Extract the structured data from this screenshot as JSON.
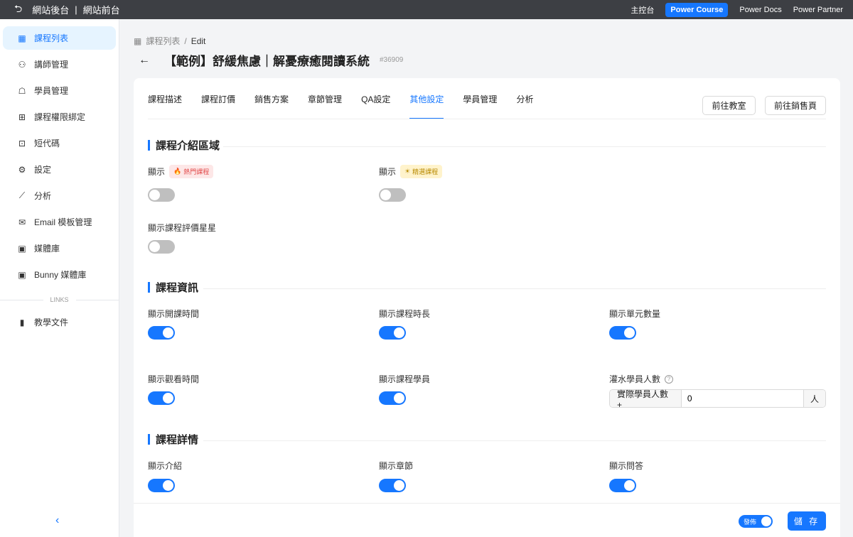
{
  "topbar": {
    "back_label": "網站後台",
    "sep": "|",
    "front_label": "網站前台",
    "links": [
      "主控台",
      "Power Course",
      "Power Docs",
      "Power Partner"
    ]
  },
  "sidebar": {
    "items": [
      {
        "label": "課程列表",
        "icon": "table-icon"
      },
      {
        "label": "講師管理",
        "icon": "user-icon"
      },
      {
        "label": "學員管理",
        "icon": "student-icon"
      },
      {
        "label": "課程權限綁定",
        "icon": "grid-icon"
      },
      {
        "label": "短代碼",
        "icon": "code-icon"
      },
      {
        "label": "設定",
        "icon": "gear-icon"
      },
      {
        "label": "分析",
        "icon": "chart-icon"
      },
      {
        "label": "Email 模板管理",
        "icon": "mail-icon"
      },
      {
        "label": "媒體庫",
        "icon": "media-icon"
      },
      {
        "label": "Bunny 媒體庫",
        "icon": "media-icon"
      }
    ],
    "links_title": "LINKS",
    "link_items": [
      {
        "label": "教學文件",
        "icon": "book-icon"
      }
    ]
  },
  "breadcrumb": {
    "parent": "課程列表",
    "sep": "/",
    "current": "Edit"
  },
  "page": {
    "title": "【範例】舒緩焦慮｜解憂療癒閱讀系統",
    "id": "#36909"
  },
  "tabs": [
    "課程描述",
    "課程訂價",
    "銷售方案",
    "章節管理",
    "QA設定",
    "其他設定",
    "學員管理",
    "分析"
  ],
  "buttons": {
    "goto_class": "前往教室",
    "goto_sales": "前往銷售頁"
  },
  "sections": {
    "intro": {
      "title": "課程介紹區域",
      "show_label": "顯示",
      "hot_tag": "熱門課程",
      "pick_tag": "精選課程",
      "rating_label": "顯示課程評價星星",
      "hot": false,
      "pick": false,
      "rating": false
    },
    "info": {
      "title": "課程資訊",
      "fields": [
        "顯示開課時間",
        "顯示課程時長",
        "顯示單元數量",
        "顯示觀看時間",
        "顯示課程學員"
      ],
      "extra_label": "灌水學員人數",
      "addon_before": "實際學員人數 +",
      "extra_value": "0",
      "addon_after": "人"
    },
    "detail": {
      "title": "課程詳情",
      "fields": [
        "顯示介紹",
        "顯示章節",
        "顯示問答"
      ]
    }
  },
  "footer": {
    "publish_label": "發佈",
    "save_label": "儲 存"
  }
}
